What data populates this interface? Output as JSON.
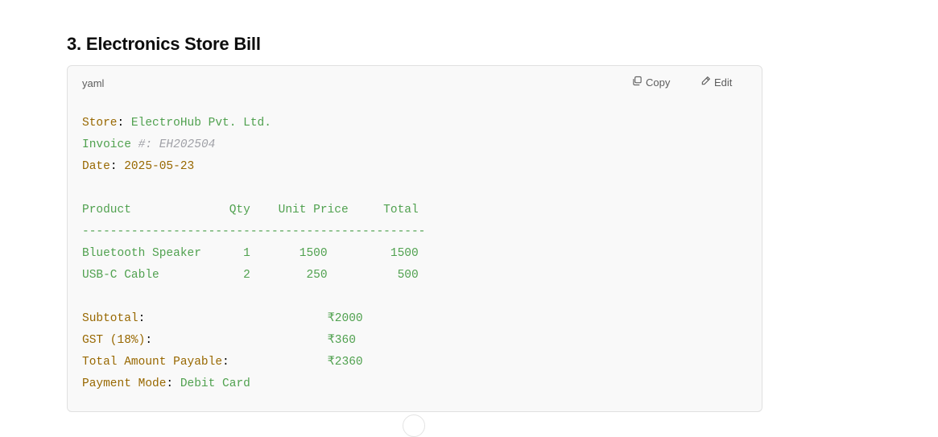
{
  "heading": "3. Electronics Store Bill",
  "code_block": {
    "language": "yaml",
    "copy_label": "Copy",
    "edit_label": "Edit",
    "icons": {
      "copy": "copy-icon",
      "edit": "pencil-icon"
    },
    "lines": [
      [
        {
          "t": "Store",
          "c": "k"
        },
        {
          "t": ": ",
          "c": ""
        },
        {
          "t": "ElectroHub Pvt. Ltd.",
          "c": "s"
        }
      ],
      [
        {
          "t": "Invoice ",
          "c": "s"
        },
        {
          "t": "#: EH202504",
          "c": "c"
        }
      ],
      [
        {
          "t": "Date",
          "c": "k"
        },
        {
          "t": ": ",
          "c": ""
        },
        {
          "t": "2025-05-23",
          "c": "k"
        }
      ],
      [],
      [
        {
          "t": "Product              Qty    Unit Price     Total",
          "c": "s"
        }
      ],
      [
        {
          "t": "-------------------------------------------------",
          "c": "s"
        }
      ],
      [
        {
          "t": "Bluetooth Speaker      1       1500         1500",
          "c": "s"
        }
      ],
      [
        {
          "t": "USB-C Cable            2        250          500",
          "c": "s"
        }
      ],
      [],
      [
        {
          "t": "Subtotal",
          "c": "k"
        },
        {
          "t": ":                          ",
          "c": ""
        },
        {
          "t": "₹2000",
          "c": "s"
        }
      ],
      [
        {
          "t": "GST (18%)",
          "c": "k"
        },
        {
          "t": ":                         ",
          "c": ""
        },
        {
          "t": "₹360",
          "c": "s"
        }
      ],
      [
        {
          "t": "Total Amount Payable",
          "c": "k"
        },
        {
          "t": ":              ",
          "c": ""
        },
        {
          "t": "₹2360",
          "c": "s"
        }
      ],
      [
        {
          "t": "Payment Mode",
          "c": "k"
        },
        {
          "t": ": ",
          "c": ""
        },
        {
          "t": "Debit Card",
          "c": "s"
        }
      ]
    ]
  },
  "colors": {
    "key": "#986801",
    "string": "#50a14f",
    "comment": "#a0a1a7"
  }
}
